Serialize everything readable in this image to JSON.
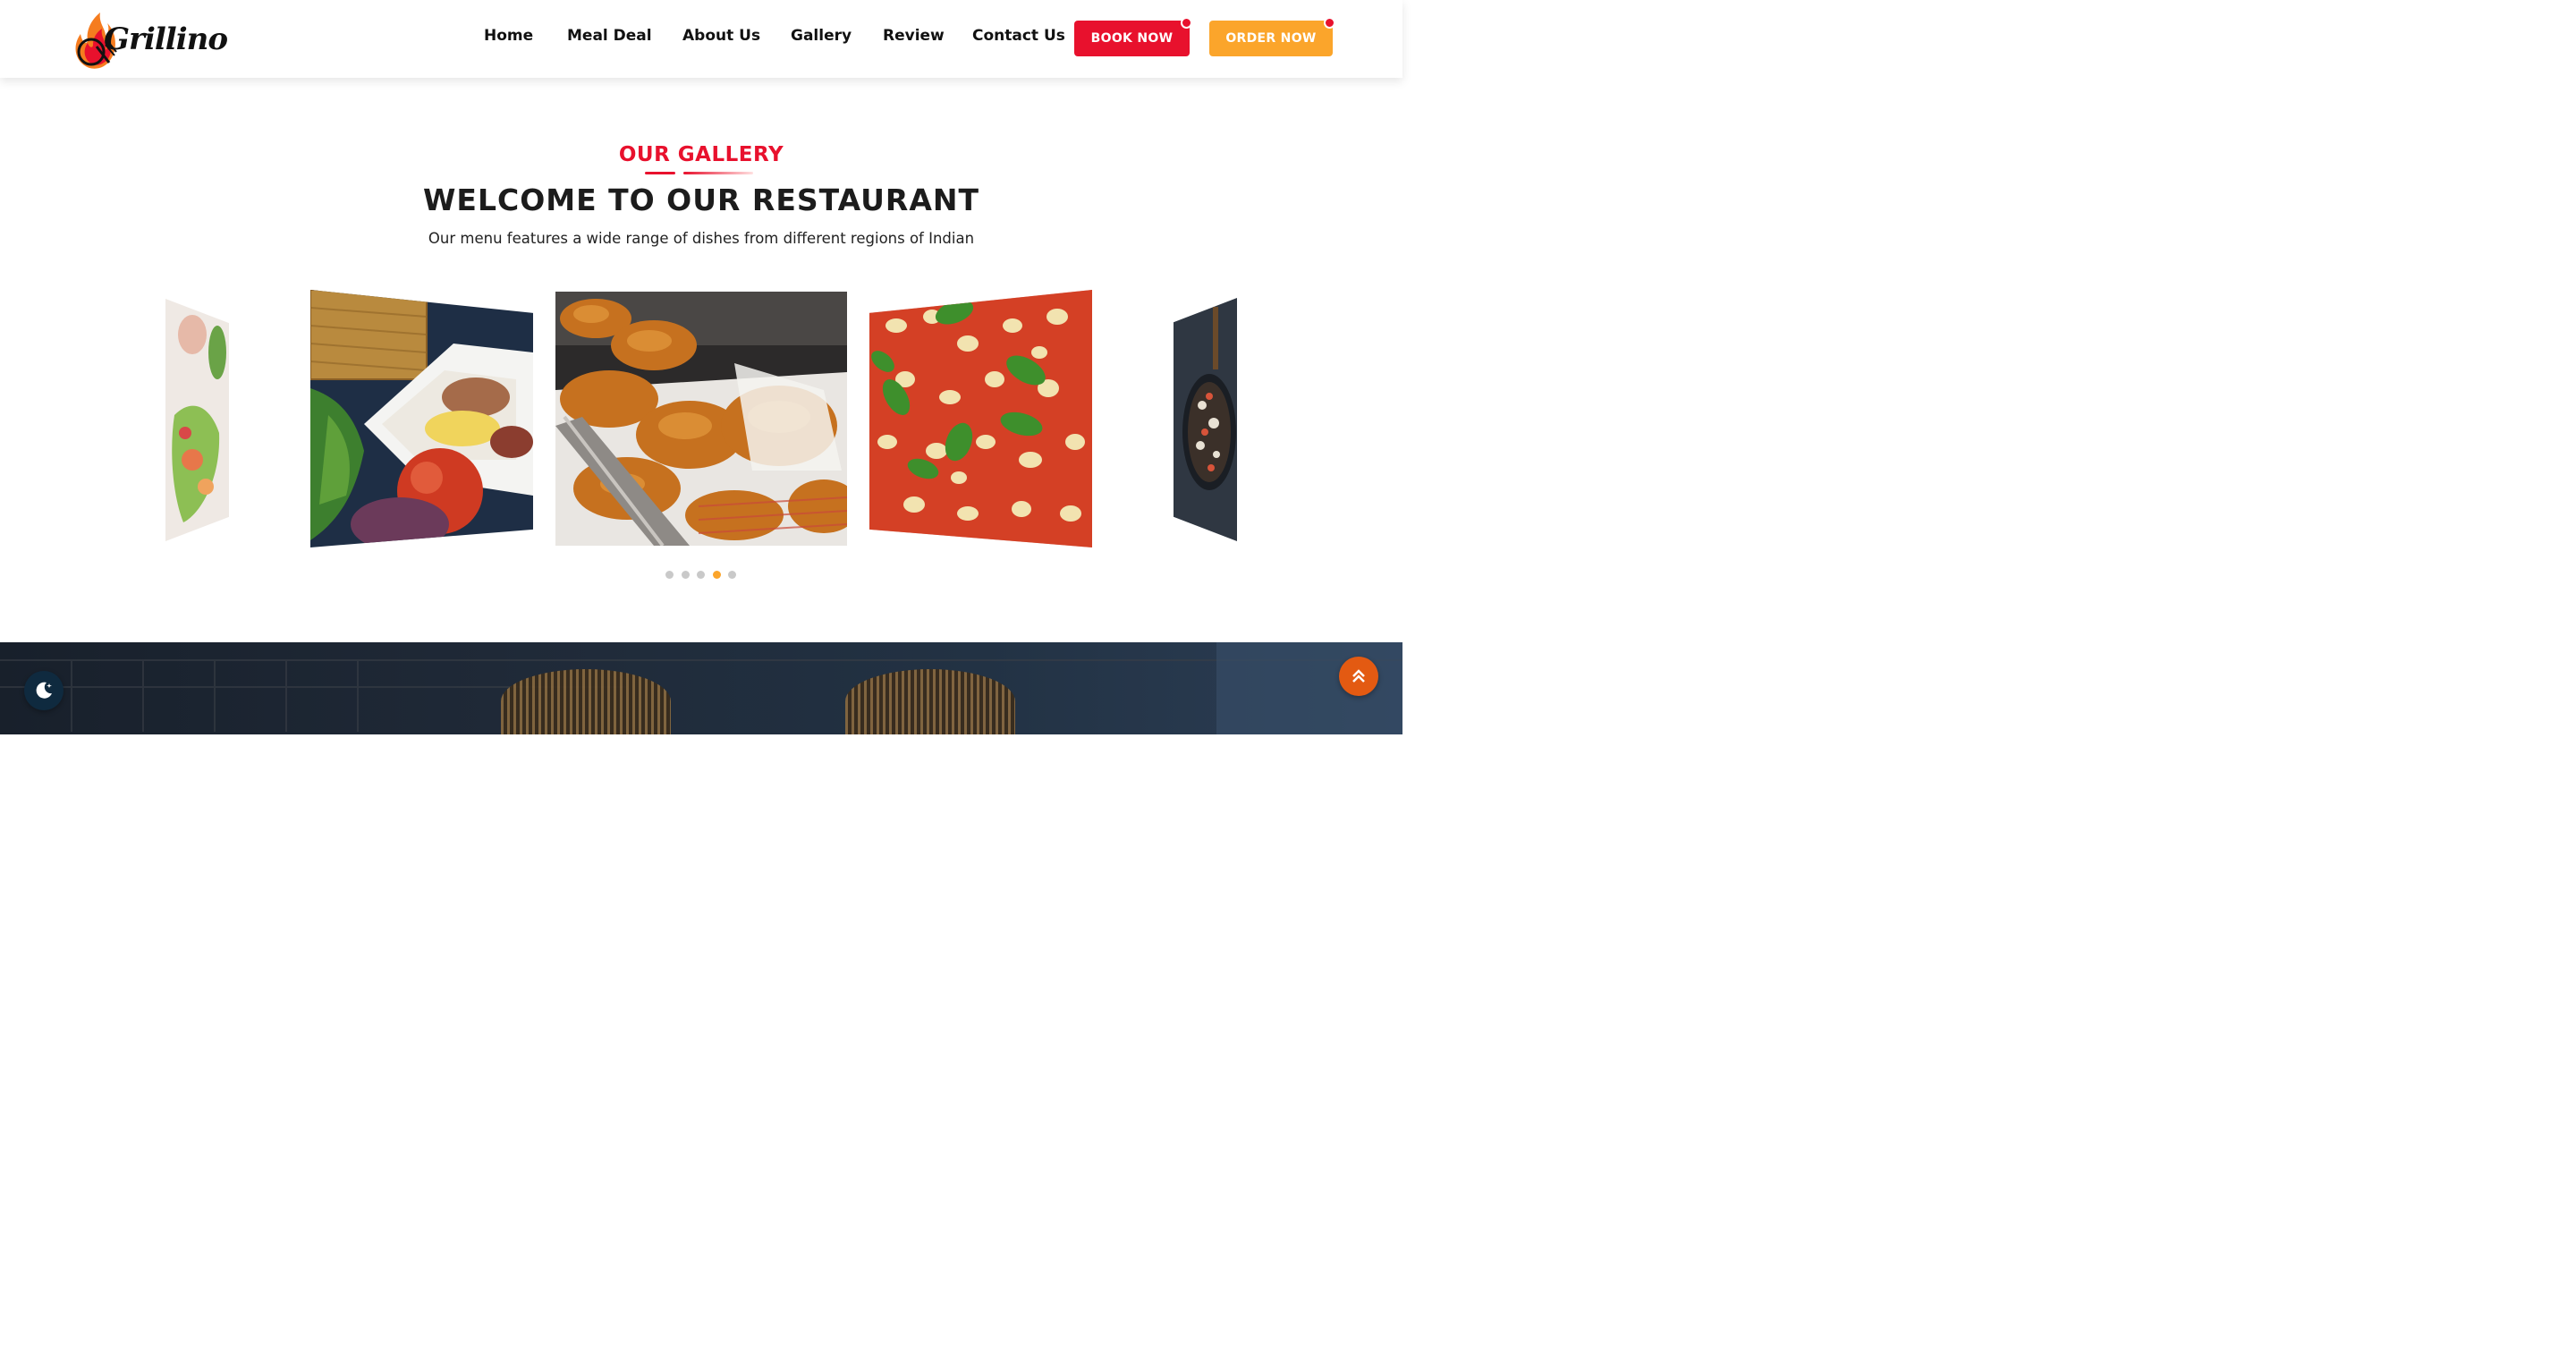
{
  "brand": {
    "logo_text": "Grillino"
  },
  "nav": {
    "items": [
      {
        "label": "Home"
      },
      {
        "label": "Meal Deal"
      },
      {
        "label": "About Us"
      },
      {
        "label": "Gallery"
      },
      {
        "label": "Review"
      },
      {
        "label": "Contact Us"
      }
    ],
    "book_label": "BOOK NOW",
    "order_label": "ORDER NOW"
  },
  "gallery": {
    "eyebrow": "OUR GALLERY",
    "title": "WELCOME TO OUR RESTAURANT",
    "subtitle": "Our menu features a wide range of dishes from different regions of Indian",
    "slides": [
      {
        "icon": "salad-image"
      },
      {
        "icon": "vegetables-platter-image"
      },
      {
        "icon": "fried-chicken-image"
      },
      {
        "icon": "pizza-image"
      },
      {
        "icon": "pan-dish-image"
      }
    ],
    "dots_total": 5,
    "active_dot": 4
  },
  "colors": {
    "accent_red": "#e8112d",
    "accent_orange": "#fba52b",
    "scroll_top": "#e35a12",
    "moon_bg": "#0f2a3f"
  },
  "icons": {
    "moon": "moon-icon",
    "scroll_top": "double-chevron-up-icon",
    "logo": "flame-fork-icon"
  }
}
